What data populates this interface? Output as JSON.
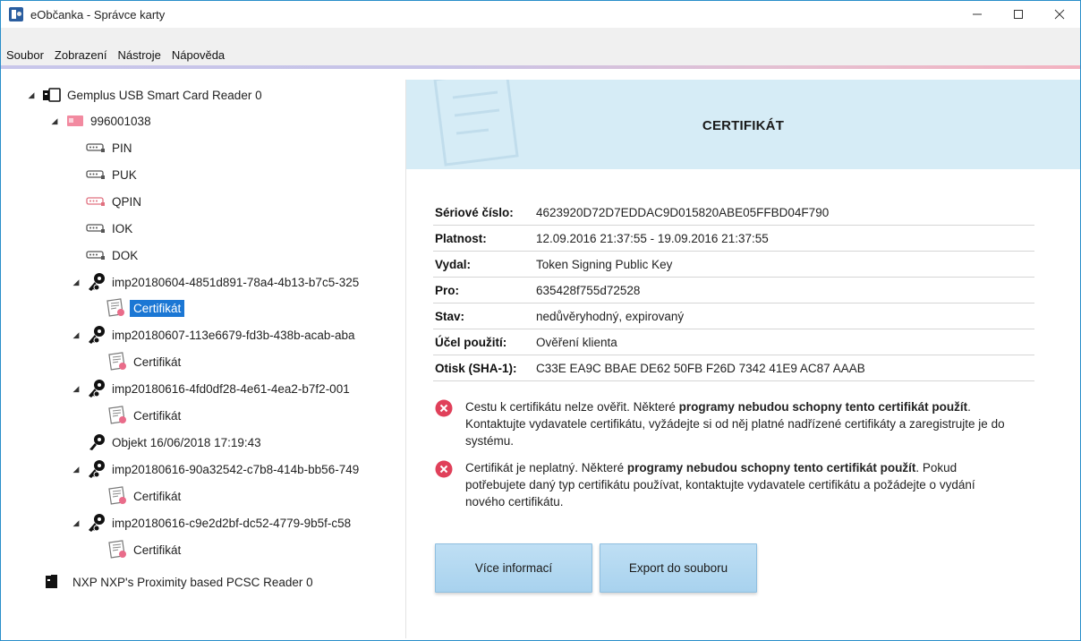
{
  "window": {
    "title": "eObčanka - Správce karty"
  },
  "menu": [
    {
      "label": "Soubor"
    },
    {
      "label": "Zobrazení"
    },
    {
      "label": "Nástroje"
    },
    {
      "label": "Nápověda"
    }
  ],
  "tree": {
    "reader1": "Gemplus USB Smart Card Reader 0",
    "card": "996001038",
    "pin": "PIN",
    "puk": "PUK",
    "qpin": "QPIN",
    "iok": "IOK",
    "dok": "DOK",
    "key1": "imp20180604-4851d891-78a4-4b13-b7c5-325",
    "cert1": "Certifikát",
    "key2": "imp20180607-113e6679-fd3b-438b-acab-aba",
    "cert2": "Certifikát",
    "key3": "imp20180616-4fd0df28-4e61-4ea2-b7f2-001",
    "cert3": "Certifikát",
    "object": "Objekt 16/06/2018 17:19:43",
    "key4": "imp20180616-90a32542-c7b8-414b-bb56-749",
    "cert4": "Certifikát",
    "key5": "imp20180616-c9e2d2bf-dc52-4779-9b5f-c58",
    "cert5": "Certifikát",
    "reader2": "NXP NXP's Proximity based PCSC Reader 0"
  },
  "main": {
    "title": "CERTIFIKÁT",
    "props": [
      {
        "key": "Sériové číslo:",
        "value": "4623920D72D7EDDAC9D015820ABE05FFBD04F790"
      },
      {
        "key": "Platnost:",
        "value": "12.09.2016 21:37:55 - 19.09.2016 21:37:55"
      },
      {
        "key": "Vydal:",
        "value": "Token Signing Public Key"
      },
      {
        "key": "Pro:",
        "value": "635428f755d72528"
      },
      {
        "key": "Stav:",
        "value": "nedůvěryhodný, expirovaný"
      },
      {
        "key": "Účel použití:",
        "value": "Ověření klienta"
      },
      {
        "key": "Otisk (SHA-1):",
        "value": "C33E EA9C BBAE DE62 50FB F26D 7342 41E9 AC87 AAAB"
      }
    ],
    "warning1": {
      "pre": "Cestu k certifikátu nelze ověřit. Některé ",
      "bold": "programy nebudou schopny tento certifikát použít",
      "post": ". Kontaktujte vydavatele certifikátu, vyžádejte si od něj platné nadřízené certifikáty a zaregistrujte je do systému."
    },
    "warning2": {
      "pre": "Certifikát je neplatný. Některé ",
      "bold": "programy nebudou schopny tento certifikát použít",
      "post": ". Pokud potřebujete daný typ certifikátu používat, kontaktujte vydavatele certifikátu a požádejte o vydání nového certifikátu."
    },
    "buttons": {
      "more": "Více informací",
      "export": "Export do souboru"
    }
  },
  "colors": {
    "accent": "#1b77d4",
    "banner": "#d6ecf6",
    "error": "#e0405a",
    "button": "#b4d9f1"
  }
}
